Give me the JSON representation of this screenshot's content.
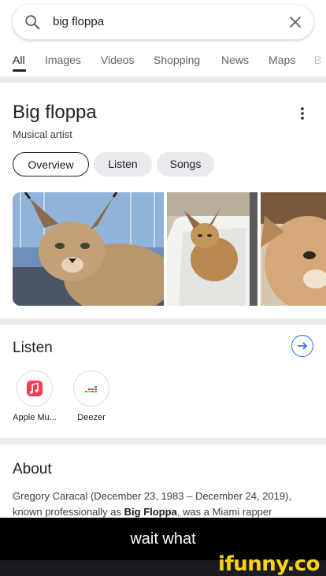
{
  "search": {
    "query": "big floppa"
  },
  "tabs": [
    {
      "label": "All"
    },
    {
      "label": "Images"
    },
    {
      "label": "Videos"
    },
    {
      "label": "Shopping"
    },
    {
      "label": "News"
    },
    {
      "label": "Maps"
    },
    {
      "label": "B"
    }
  ],
  "knowledge_panel": {
    "title": "Big floppa",
    "subtitle": "Musical artist",
    "chips": [
      {
        "label": "Overview"
      },
      {
        "label": "Listen"
      },
      {
        "label": "Songs"
      }
    ]
  },
  "listen": {
    "title": "Listen",
    "apps": [
      {
        "label": "Apple Mu...",
        "icon": "apple-music-icon"
      },
      {
        "label": "Deezer",
        "icon": "deezer-icon"
      }
    ]
  },
  "about": {
    "title": "About",
    "text_before": "Gregory Caracal (December 23, 1983 – December 24, 2019), known professionally as ",
    "bold": "Big Floppa",
    "text_after": ", was a Miami rapper"
  },
  "meme": {
    "caption": "wait what"
  },
  "watermark": {
    "label": "ifunny.co"
  },
  "colors": {
    "accent": "#1a73e8",
    "caption_bg": "#000000",
    "watermark": "#f7d31b"
  }
}
